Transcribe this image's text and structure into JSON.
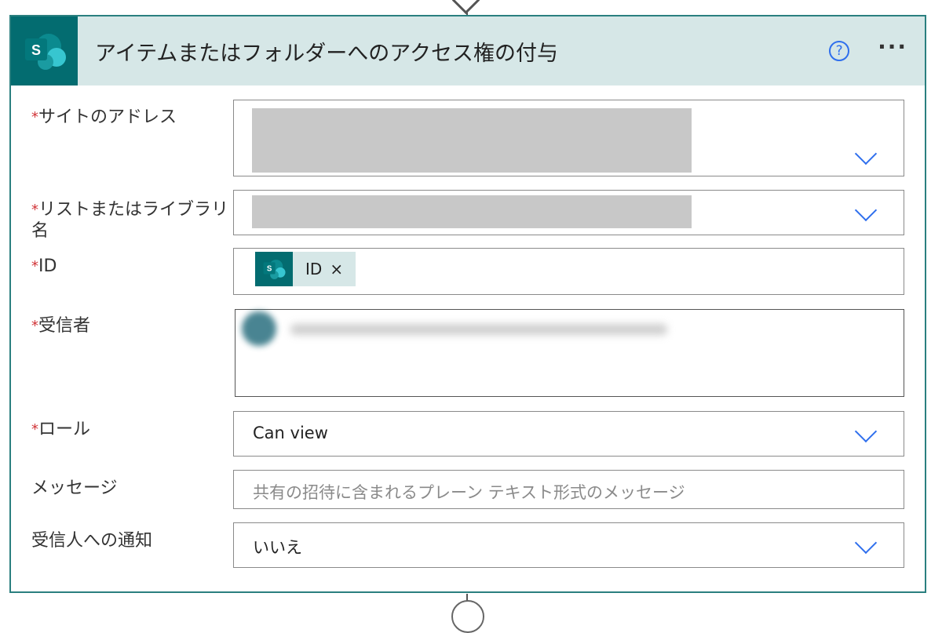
{
  "card": {
    "title": "アイテムまたはフォルダーへのアクセス権の付与",
    "help_icon": "?",
    "more_icon": "···"
  },
  "fields": {
    "site_address": {
      "label": "サイトのアドレス",
      "required": "*"
    },
    "list_name": {
      "label": "リストまたはライブラリ名",
      "required": "*"
    },
    "id": {
      "label": "ID",
      "required": "*",
      "token_label": "ID",
      "token_remove": "×"
    },
    "recipients": {
      "label": "受信者",
      "required": "*"
    },
    "role": {
      "label": "ロール",
      "required": "*",
      "value": "Can view"
    },
    "message": {
      "label": "メッセージ",
      "placeholder": "共有の招待に含まれるプレーン テキスト形式のメッセージ"
    },
    "notify": {
      "label": "受信人への通知",
      "value": "いいえ"
    }
  },
  "icons": {
    "sharepoint": "sharepoint-icon",
    "dropdown": "chevron-down-icon",
    "help": "help-icon",
    "more": "more-options-icon"
  },
  "colors": {
    "header_bg": "#d6e7e7",
    "sharepoint_teal": "#036c70",
    "card_border": "#2a7f7f",
    "accent_blue": "#2f6fed",
    "required_red": "#d13438"
  }
}
